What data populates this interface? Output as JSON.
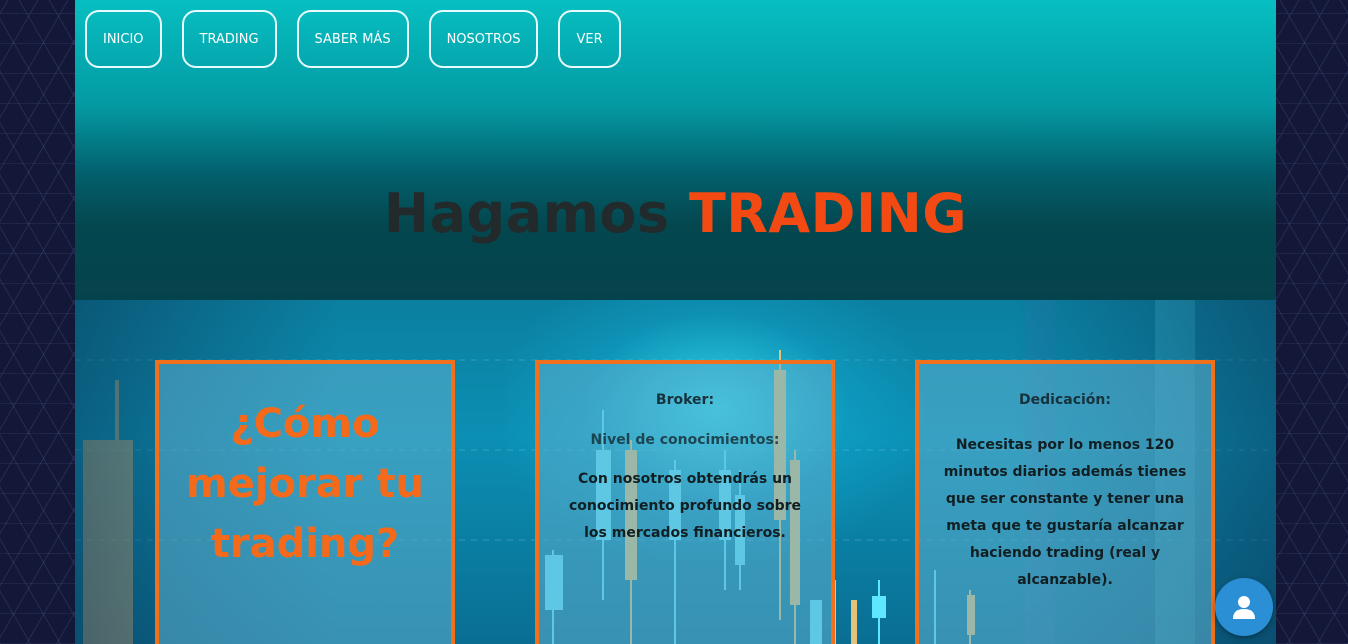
{
  "nav": {
    "items": [
      {
        "label": "INICIO"
      },
      {
        "label": "TRADING"
      },
      {
        "label": "SABER MÁS"
      },
      {
        "label": "NOSOTROS"
      },
      {
        "label": "VER"
      }
    ]
  },
  "hero": {
    "title_part1": "Hagamos",
    "title_part2": "TRADING"
  },
  "cards": {
    "card1": {
      "question": "¿Cómo mejorar tu trading?"
    },
    "card2": {
      "heading": "Broker:",
      "subheading": "Nivel de conocimientos:",
      "text": "Con nosotros obtendrás un conocimiento profundo sobre los mercados financieros."
    },
    "card3": {
      "heading": "Dedicación:",
      "text": "Necesitas por lo menos 120 minutos diarios además tienes que ser constante y tener una meta que te gustaría alcanzar haciendo trading (real y alcanzable)."
    }
  },
  "colors": {
    "accent": "#f24a12",
    "card_border": "#f0701c",
    "chat_button": "#2b8fd6"
  },
  "icons": {
    "chat": "user-avatar-icon"
  }
}
